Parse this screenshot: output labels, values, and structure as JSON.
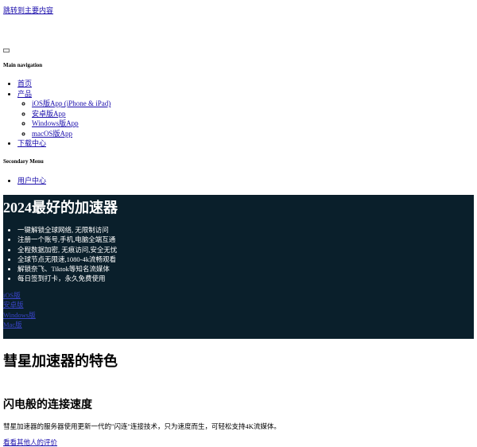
{
  "skip_link": "跳转到主要内容",
  "main_nav": {
    "heading": "Main navigation",
    "items": [
      {
        "label": "首页"
      },
      {
        "label": "产品",
        "children": [
          "iOS版App (iPhone & iPad)",
          "安卓版App",
          "Windows版App",
          "macOS版App"
        ]
      },
      {
        "label": "下载中心"
      }
    ]
  },
  "secondary_nav": {
    "heading": "Secondary Menu",
    "items": [
      {
        "label": "用户中心"
      }
    ]
  },
  "hero": {
    "title": "2024最好的加速器",
    "features": [
      "一键解锁全球网络, 无限制访问",
      "注册一个账号,手机,电脑全端互通",
      "全程数据加密, 无痕访问,安全无忧",
      "全球节点无限速,1080-4k流畅观看",
      "解锁奈飞、Tiktok等知名流媒体",
      "每日签到打卡，永久免费使用"
    ],
    "download_links": [
      "iOS版",
      "安卓版",
      "Windows版",
      "Mac版"
    ],
    "background": "#0a1f2b"
  },
  "section": {
    "title": "彗星加速器的特色",
    "feature_title": "闪电般的连接速度",
    "feature_desc": "彗星加速器的服务器使用更新一代的\"闪连\"连接技术，只为速度而生，可轻松支持4K流媒体。",
    "review_link": "看看其他人的评价"
  }
}
